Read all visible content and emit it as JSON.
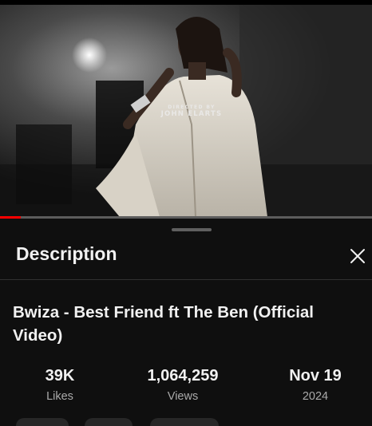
{
  "video": {
    "credit_line1": "DIRECTED BY",
    "credit_line2": "JOHN ELARTS",
    "progress_fraction": 0.055
  },
  "description_panel": {
    "title": "Description",
    "close_icon": "close-icon"
  },
  "video_info": {
    "title": "Bwiza - Best Friend ft The Ben (Official Video)"
  },
  "stats": {
    "likes": {
      "value": "39K",
      "label": "Likes"
    },
    "views": {
      "value": "1,064,259",
      "label": "Views"
    },
    "date": {
      "value": "Nov 19",
      "label": "2024"
    }
  },
  "colors": {
    "background": "#0f0f0f",
    "progress": "#ff0000",
    "secondary_text": "#aaaaaa"
  }
}
